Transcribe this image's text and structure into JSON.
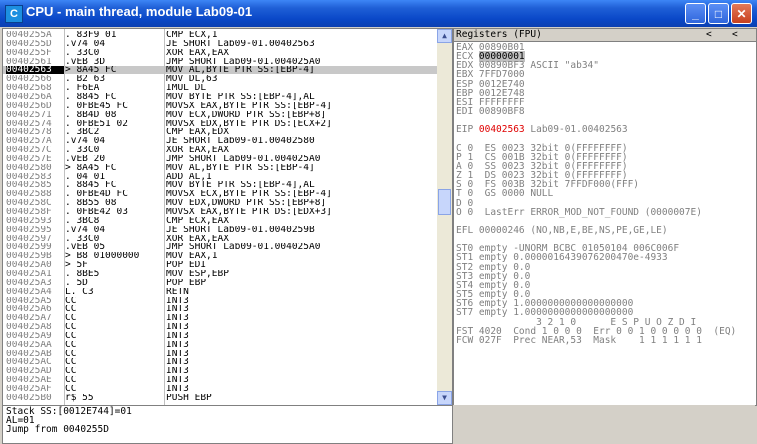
{
  "window": {
    "title": "CPU - main thread, module Lab09-01",
    "icon_letter": "C"
  },
  "disasm": {
    "current_address": "00402563",
    "rows": [
      {
        "addr": "0040255A",
        "hex": ". 83F9 01",
        "asm": "CMP ECX,1"
      },
      {
        "addr": "0040255D",
        "hex": ".v74 04",
        "asm": "JE SHORT Lab09-01.00402563"
      },
      {
        "addr": "0040255F",
        "hex": ". 33C0",
        "asm": "XOR EAX,EAX"
      },
      {
        "addr": "00402561",
        "hex": ".vEB 3D",
        "asm": "JMP SHORT Lab09-01.004025A0"
      },
      {
        "addr": "00402563",
        "hex": "> 8A45 FC",
        "asm": "MOV AL,BYTE PTR SS:[EBP-4]"
      },
      {
        "addr": "00402566",
        "hex": ". B2 63",
        "asm": "MOV DL,63"
      },
      {
        "addr": "00402568",
        "hex": ". F6EA",
        "asm": "IMUL DL"
      },
      {
        "addr": "0040256A",
        "hex": ". 8845 FC",
        "asm": "MOV BYTE PTR SS:[EBP-4],AL"
      },
      {
        "addr": "0040256D",
        "hex": ". 0FBE45 FC",
        "asm": "MOVSX EAX,BYTE PTR SS:[EBP-4]"
      },
      {
        "addr": "00402571",
        "hex": ". 8B4D 08",
        "asm": "MOV ECX,DWORD PTR SS:[EBP+8]"
      },
      {
        "addr": "00402574",
        "hex": ". 0FBE51 02",
        "asm": "MOVSX EDX,BYTE PTR DS:[ECX+2]"
      },
      {
        "addr": "00402578",
        "hex": ". 3BC2",
        "asm": "CMP EAX,EDX"
      },
      {
        "addr": "0040257A",
        "hex": ".v74 04",
        "asm": "JE SHORT Lab09-01.00402580"
      },
      {
        "addr": "0040257C",
        "hex": ". 33C0",
        "asm": "XOR EAX,EAX"
      },
      {
        "addr": "0040257E",
        "hex": ".vEB 20",
        "asm": "JMP SHORT Lab09-01.004025A0"
      },
      {
        "addr": "00402580",
        "hex": "> 8A45 FC",
        "asm": "MOV AL,BYTE PTR SS:[EBP-4]"
      },
      {
        "addr": "00402583",
        "hex": ". 04 01",
        "asm": "ADD AL,1"
      },
      {
        "addr": "00402585",
        "hex": ". 8845 FC",
        "asm": "MOV BYTE PTR SS:[EBP-4],AL"
      },
      {
        "addr": "00402588",
        "hex": ". 0FBE4D FC",
        "asm": "MOVSX ECX,BYTE PTR SS:[EBP-4]"
      },
      {
        "addr": "0040258C",
        "hex": ". 8B55 08",
        "asm": "MOV EDX,DWORD PTR SS:[EBP+8]"
      },
      {
        "addr": "0040258F",
        "hex": ". 0FBE42 03",
        "asm": "MOVSX EAX,BYTE PTR DS:[EDX+3]"
      },
      {
        "addr": "00402593",
        "hex": ". 3BC8",
        "asm": "CMP ECX,EAX"
      },
      {
        "addr": "00402595",
        "hex": ".v74 04",
        "asm": "JE SHORT Lab09-01.0040259B"
      },
      {
        "addr": "00402597",
        "hex": ". 33C0",
        "asm": "XOR EAX,EAX"
      },
      {
        "addr": "00402599",
        "hex": ".vEB 05",
        "asm": "JMP SHORT Lab09-01.004025A0"
      },
      {
        "addr": "0040259B",
        "hex": "> B8 01000000",
        "asm": "MOV EAX,1"
      },
      {
        "addr": "004025A0",
        "hex": "> 5F",
        "asm": "POP EDI"
      },
      {
        "addr": "004025A1",
        "hex": ". 8BE5",
        "asm": "MOV ESP,EBP"
      },
      {
        "addr": "004025A3",
        "hex": ". 5D",
        "asm": "POP EBP"
      },
      {
        "addr": "004025A4",
        "hex": "L. C3",
        "asm": "RETN"
      },
      {
        "addr": "004025A5",
        "hex": "  CC",
        "asm": "INT3"
      },
      {
        "addr": "004025A6",
        "hex": "  CC",
        "asm": "INT3"
      },
      {
        "addr": "004025A7",
        "hex": "  CC",
        "asm": "INT3"
      },
      {
        "addr": "004025A8",
        "hex": "  CC",
        "asm": "INT3"
      },
      {
        "addr": "004025A9",
        "hex": "  CC",
        "asm": "INT3"
      },
      {
        "addr": "004025AA",
        "hex": "  CC",
        "asm": "INT3"
      },
      {
        "addr": "004025AB",
        "hex": "  CC",
        "asm": "INT3"
      },
      {
        "addr": "004025AC",
        "hex": "  CC",
        "asm": "INT3"
      },
      {
        "addr": "004025AD",
        "hex": "  CC",
        "asm": "INT3"
      },
      {
        "addr": "004025AE",
        "hex": "  CC",
        "asm": "INT3"
      },
      {
        "addr": "004025AF",
        "hex": "  CC",
        "asm": "INT3"
      },
      {
        "addr": "004025B0",
        "hex": "r$ 55",
        "asm": "PUSH EBP"
      }
    ]
  },
  "registers": {
    "header": "Registers (FPU)",
    "lines": [
      {
        "t": "EAX 00890B01",
        "cls": "gray"
      },
      {
        "t": "ECX 00000001",
        "cls": "gray sel"
      },
      {
        "t": "EDX 00890BF3 ASCII \"ab34\"",
        "cls": "gray"
      },
      {
        "t": "EBX 7FFD7000",
        "cls": "gray"
      },
      {
        "t": "ESP 0012E740",
        "cls": "gray"
      },
      {
        "t": "EBP 0012E748",
        "cls": "gray"
      },
      {
        "t": "ESI FFFFFFFF",
        "cls": "gray"
      },
      {
        "t": "EDI 00890BF8",
        "cls": "gray"
      },
      {
        "t": "",
        "cls": ""
      },
      {
        "t": "EIP 00402563 Lab09-01.00402563",
        "cls": "eip"
      },
      {
        "t": "",
        "cls": ""
      },
      {
        "t": "C 0  ES 0023 32bit 0(FFFFFFFF)",
        "cls": "gray"
      },
      {
        "t": "P 1  CS 001B 32bit 0(FFFFFFFF)",
        "cls": "gray"
      },
      {
        "t": "A 0  SS 0023 32bit 0(FFFFFFFF)",
        "cls": "gray"
      },
      {
        "t": "Z 1  DS 0023 32bit 0(FFFFFFFF)",
        "cls": "gray"
      },
      {
        "t": "S 0  FS 003B 32bit 7FFDF000(FFF)",
        "cls": "gray"
      },
      {
        "t": "T 0  GS 0000 NULL",
        "cls": "gray"
      },
      {
        "t": "D 0",
        "cls": "gray"
      },
      {
        "t": "O 0  LastErr ERROR_MOD_NOT_FOUND (0000007E)",
        "cls": "gray"
      },
      {
        "t": "",
        "cls": ""
      },
      {
        "t": "EFL 00000246 (NO,NB,E,BE,NS,PE,GE,LE)",
        "cls": "gray"
      },
      {
        "t": "",
        "cls": ""
      },
      {
        "t": "ST0 empty -UNORM BCBC 01050104 006C006F",
        "cls": "gray"
      },
      {
        "t": "ST1 empty 0.0000016439076200470e-4933",
        "cls": "gray"
      },
      {
        "t": "ST2 empty 0.0",
        "cls": "gray"
      },
      {
        "t": "ST3 empty 0.0",
        "cls": "gray"
      },
      {
        "t": "ST4 empty 0.0",
        "cls": "gray"
      },
      {
        "t": "ST5 empty 0.0",
        "cls": "gray"
      },
      {
        "t": "ST6 empty 1.0000000000000000000",
        "cls": "gray"
      },
      {
        "t": "ST7 empty 1.0000000000000000000",
        "cls": "gray"
      },
      {
        "t": "              3 2 1 0      E S P U O Z D I",
        "cls": "gray"
      },
      {
        "t": "FST 4020  Cond 1 0 0 0  Err 0 0 1 0 0 0 0 0  (EQ)",
        "cls": "gray"
      },
      {
        "t": "FCW 027F  Prec NEAR,53  Mask    1 1 1 1 1 1",
        "cls": "gray"
      }
    ],
    "nav_left": "<",
    "nav_right": "<"
  },
  "info": {
    "lines": [
      "Stack SS:[0012E744]=01",
      "AL=01",
      "Jump from 0040255D"
    ]
  }
}
